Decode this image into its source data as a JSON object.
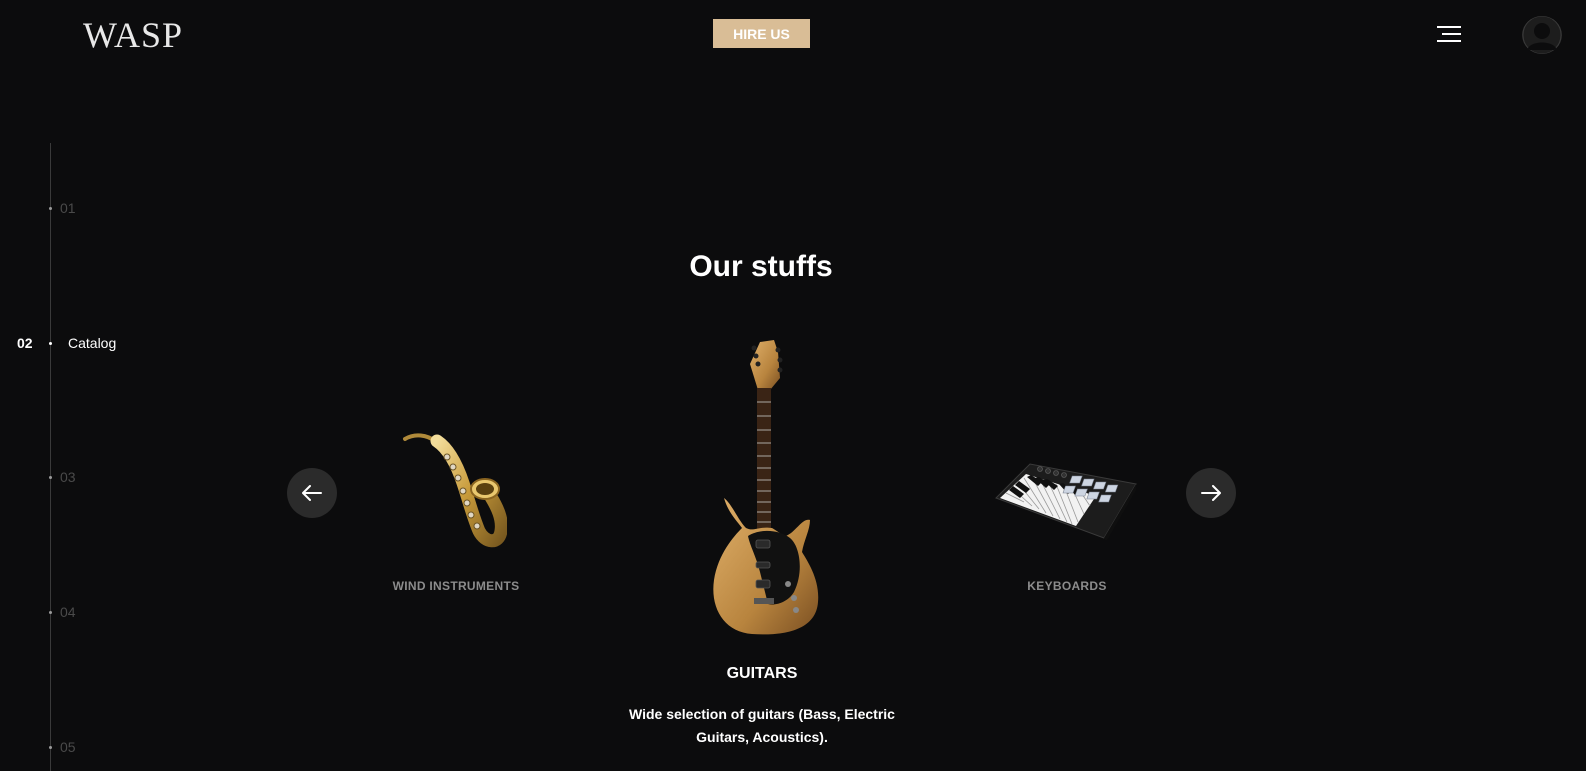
{
  "header": {
    "logo": "WASP",
    "hire_label": "HIRE US"
  },
  "timeline": [
    {
      "num": "01",
      "label": "",
      "active": false
    },
    {
      "num": "02",
      "label": "Catalog",
      "active": true
    },
    {
      "num": "03",
      "label": "",
      "active": false
    },
    {
      "num": "04",
      "label": "",
      "active": false
    },
    {
      "num": "05",
      "label": "",
      "active": false
    }
  ],
  "catalog": {
    "title": "Our stuffs",
    "items": [
      {
        "name": "WIND INSTRUMENTS",
        "icon": "saxophone-icon"
      },
      {
        "name": "GUITARS",
        "icon": "electric-guitar-icon",
        "description": "Wide selection of guitars (Bass, Electric Guitars, Acoustics)."
      },
      {
        "name": "KEYBOARDS",
        "icon": "midi-keyboard-icon"
      }
    ]
  },
  "colors": {
    "background": "#0c0c0d",
    "accent": "#d9bd96",
    "muted_text": "#8c8c8c",
    "button_bg": "#2b2b2b"
  }
}
